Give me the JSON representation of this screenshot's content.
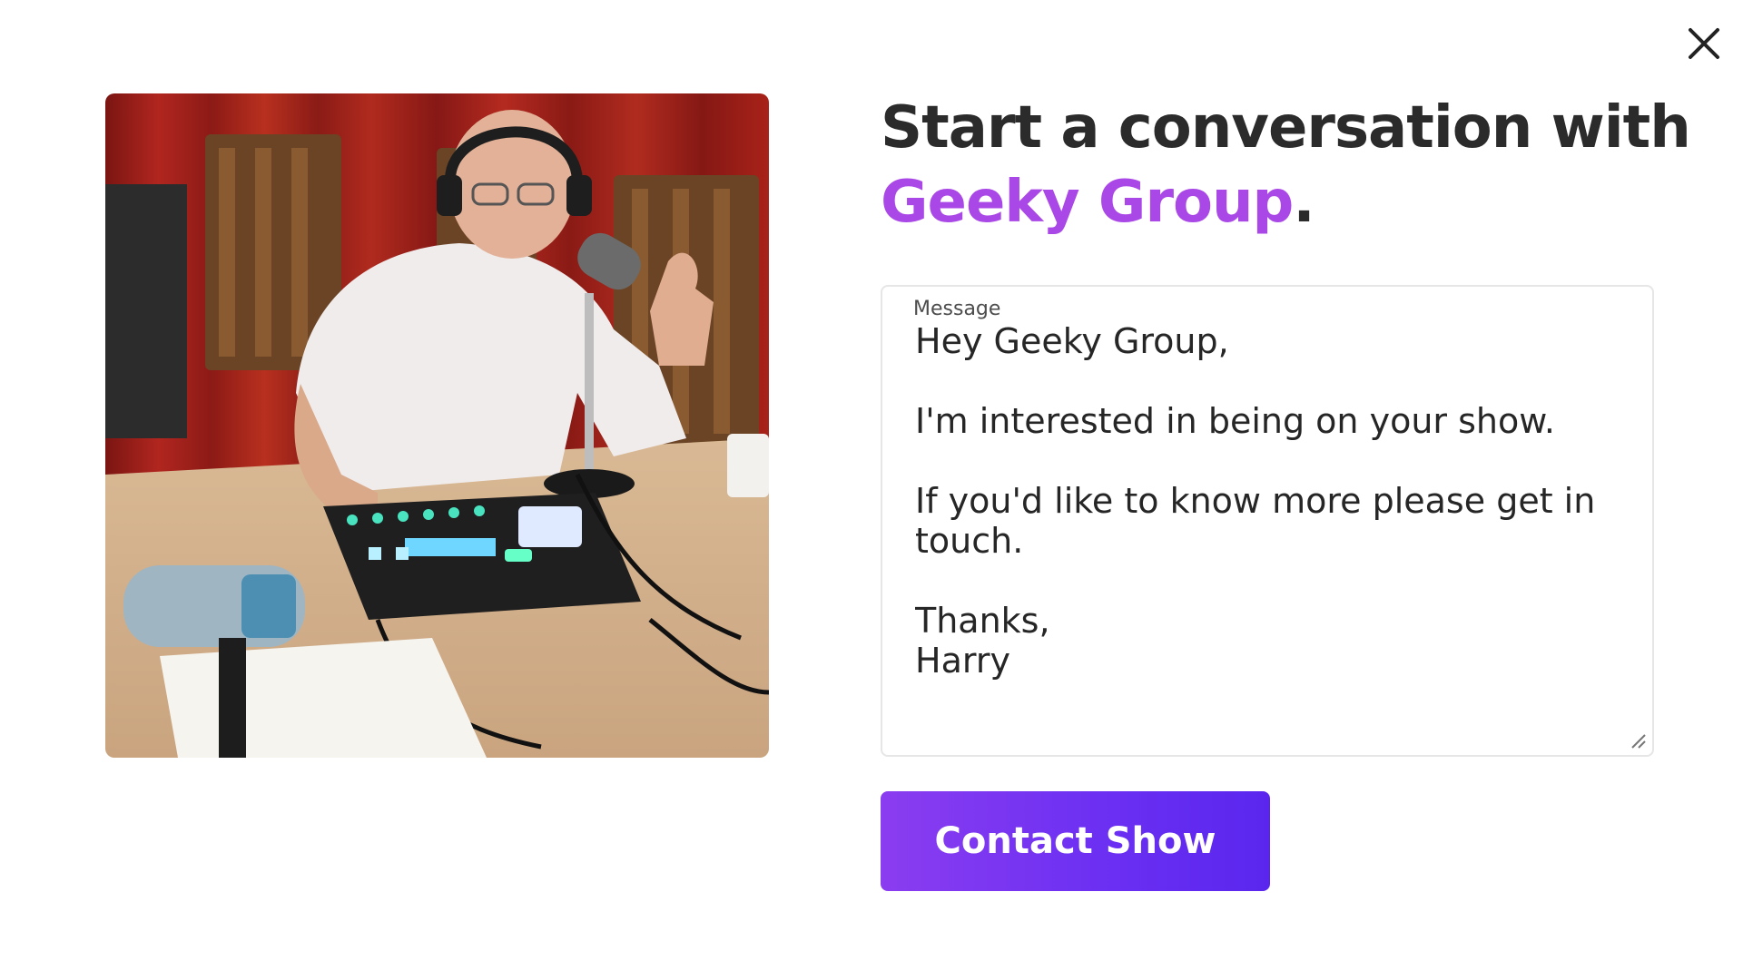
{
  "modal": {
    "close_icon": "close-icon",
    "heading_prefix": "Start a conversation with",
    "show_name": "Geeky Group",
    "heading_suffix": ".",
    "accent_color": "#a948e6",
    "photo_icon": "podcast-host-photo"
  },
  "form": {
    "message_label": "Message",
    "message_value": "Hey Geeky Group,\n\nI'm interested in being on your show.\n\nIf you'd like to know more please get in touch.\n\nThanks,\nHarry",
    "submit_label": "Contact Show",
    "button_colors": [
      "#8b3df0",
      "#5a26ee"
    ]
  }
}
